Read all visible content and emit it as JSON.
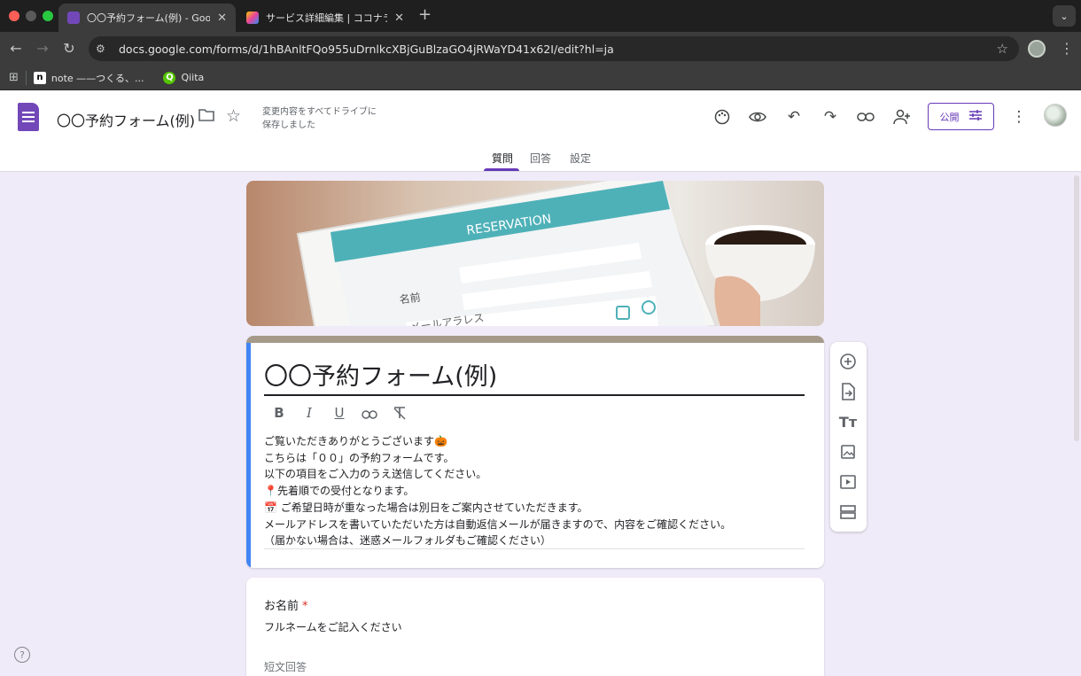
{
  "browser": {
    "tabs": [
      {
        "title": "〇〇予約フォーム(例) - Google",
        "active": true
      },
      {
        "title": "サービス詳細編集 | ココナラ",
        "active": false
      }
    ],
    "new_tab_symbol": "+",
    "close_symbol": "✕",
    "url": "docs.google.com/forms/d/1hBAnltFQo955uDrnlkcXBjGuBlzaGO4jRWaYD41x62I/edit?hl=ja",
    "bookmarks": [
      {
        "label": "note ——つくる、...",
        "icon": "n"
      },
      {
        "label": "Qiita",
        "icon": "Q"
      }
    ]
  },
  "forms_header": {
    "doc_title": "〇〇予約フォーム(例)",
    "save_status_line1": "変更内容をすべてドライブに",
    "save_status_line2": "保存しました",
    "publish_label": "公開",
    "tabs": [
      {
        "label": "質問",
        "active": true
      },
      {
        "label": "回答",
        "active": false
      },
      {
        "label": "設定",
        "active": false
      }
    ]
  },
  "banner": {
    "heading": "RESERVATION",
    "field_name": "名前",
    "field_mail": "メールアラレス"
  },
  "title_card": {
    "title": "〇〇予約フォーム(例)",
    "description": [
      "ご覧いただきありがとうございます🎃",
      "こちらは「００」の予約フォームです。",
      "以下の項目をご入力のうえ送信してください。",
      "📍先着順での受付となります。",
      "📅 ご希望日時が重なった場合は別日をご案内させていただきます。",
      "メールアドレスを書いていただいた方は自動返信メールが届きますので、内容をご確認ください。",
      "（届かない場合は、迷惑メールフォルダもご確認ください）"
    ]
  },
  "question": {
    "title": "お名前",
    "required_mark": "*",
    "help_text": "フルネームをご記入ください",
    "answer_hint": "短文回答"
  },
  "help_symbol": "?",
  "colors": {
    "brand_purple": "#673ab7",
    "form_icon": "#7248b9",
    "accent_blue": "#4285f4",
    "theme_bar": "#a59a8a",
    "canvas_bg": "#f0ebf8"
  }
}
